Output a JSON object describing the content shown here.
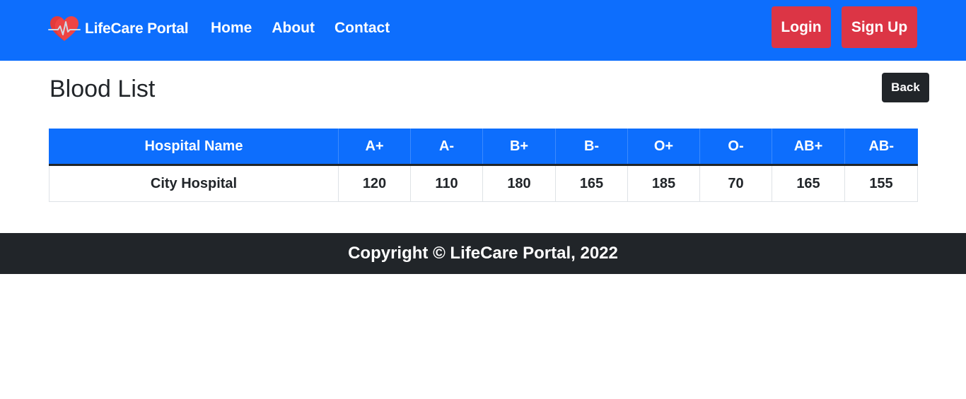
{
  "brand": {
    "name": "LifeCare Portal",
    "logo_icon": "heart-pulse-icon",
    "logo_color": "#ef4444"
  },
  "nav": {
    "items": [
      {
        "label": "Home"
      },
      {
        "label": "About"
      },
      {
        "label": "Contact"
      }
    ]
  },
  "auth": {
    "login_label": "Login",
    "signup_label": "Sign Up"
  },
  "page": {
    "title": "Blood List",
    "back_label": "Back"
  },
  "table": {
    "headers": [
      "Hospital Name",
      "A+",
      "A-",
      "B+",
      "B-",
      "O+",
      "O-",
      "AB+",
      "AB-"
    ],
    "rows": [
      [
        "City Hospital",
        "120",
        "110",
        "180",
        "165",
        "185",
        "70",
        "165",
        "155"
      ]
    ]
  },
  "footer": {
    "text": "Copyright © LifeCare Portal, 2022"
  },
  "colors": {
    "primary": "#0d6efd",
    "danger": "#dc3545",
    "dark": "#212529"
  }
}
